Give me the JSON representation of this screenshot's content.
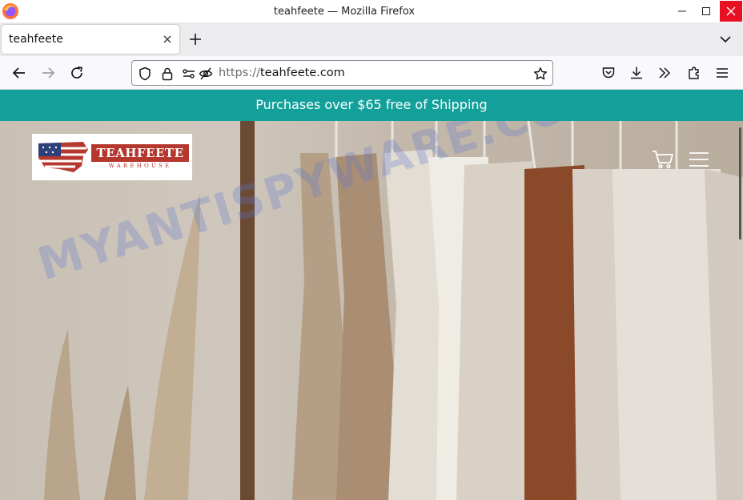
{
  "window": {
    "title": "teahfeete — Mozilla Firefox"
  },
  "tabs": [
    {
      "label": "teahfeete",
      "active": true
    }
  ],
  "navbar": {
    "url_scheme": "https://",
    "url_host": "teahfeete.com"
  },
  "page": {
    "announcement": "Purchases over $65 free of Shipping",
    "logo": {
      "brand": "TEAHFEETE",
      "sub": "WAREHOUSE"
    },
    "watermark": "MYANTISPYWARE.COM"
  },
  "colors": {
    "announcement_bg": "#14a09a",
    "brand_red": "#b5382f",
    "close_button": "#e81123"
  }
}
